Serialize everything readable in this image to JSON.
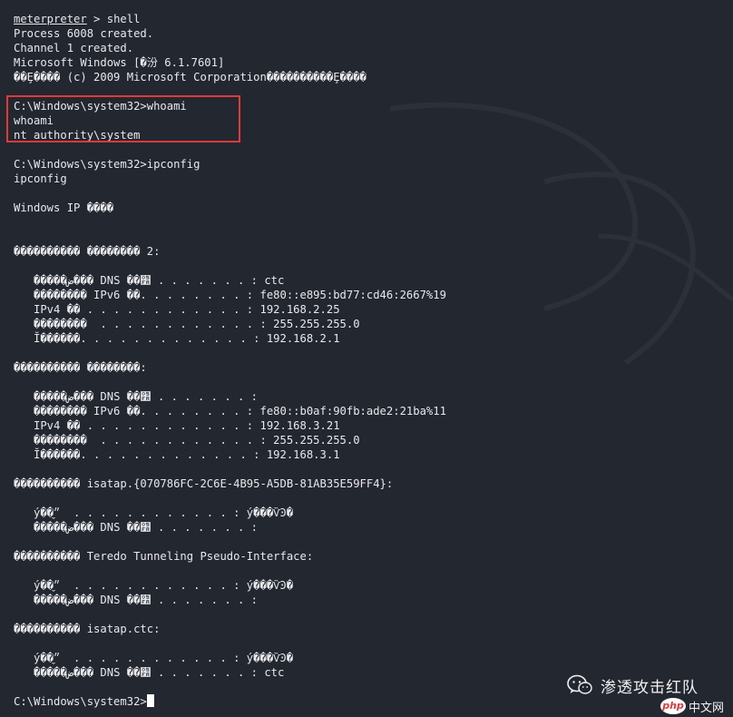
{
  "terminal": {
    "lines": [
      {
        "prompt": "meterpreter",
        "rest": " > shell"
      },
      {
        "text": "Process 6008 created."
      },
      {
        "text": "Channel 1 created."
      },
      {
        "text": "Microsoft Windows [�汾 6.1.7601]"
      },
      {
        "text": "��Ȩ���� (c) 2009 Microsoft Corporation����������Ȩ����"
      },
      {
        "text": ""
      },
      {
        "text": "C:\\Windows\\system32>whoami"
      },
      {
        "text": "whoami"
      },
      {
        "text": "nt authority\\system"
      },
      {
        "text": ""
      },
      {
        "text": "C:\\Windows\\system32>ipconfig"
      },
      {
        "text": "ipconfig"
      },
      {
        "text": ""
      },
      {
        "text": "Windows IP ����"
      },
      {
        "text": ""
      },
      {
        "text": ""
      },
      {
        "text": "���������� �������� 2:"
      },
      {
        "text": ""
      },
      {
        "text": "   �����ض��� DNS ��׺ . . . . . . . : ctc"
      },
      {
        "text": "   �������� IPv6 ��. . . . . . . . : fe80::e895:bd77:cd46:2667%19"
      },
      {
        "text": "   IPv4 �� . . . . . . . . . . . . : 192.168.2.25"
      },
      {
        "text": "   ��������  . . . . . . . . . . . . : 255.255.255.0"
      },
      {
        "text": "   Ĭ������. . . . . . . . . . . . . : 192.168.2.1"
      },
      {
        "text": ""
      },
      {
        "text": "���������� ��������:"
      },
      {
        "text": ""
      },
      {
        "text": "   �����ض��� DNS ��׺ . . . . . . . :"
      },
      {
        "text": "   �������� IPv6 ��. . . . . . . . : fe80::b0af:90fb:ade2:21ba%11"
      },
      {
        "text": "   IPv4 �� . . . . . . . . . . . . : 192.168.3.21"
      },
      {
        "text": "   ��������  . . . . . . . . . . . . : 255.255.255.0"
      },
      {
        "text": "   Ĭ������. . . . . . . . . . . . . : 192.168.3.1"
      },
      {
        "text": ""
      },
      {
        "text": "���������� isatap.{070786FC-2C6E-4B95-A5DB-81AB35E59FF4}:"
      },
      {
        "text": ""
      },
      {
        "text": "   ý��״̬  . . . . . . . . . . . . : ý���ѶϿ�"
      },
      {
        "text": "   �����ض��� DNS ��׺ . . . . . . . :"
      },
      {
        "text": ""
      },
      {
        "text": "���������� Teredo Tunneling Pseudo-Interface:"
      },
      {
        "text": ""
      },
      {
        "text": "   ý��״̬  . . . . . . . . . . . . : ý���ѶϿ�"
      },
      {
        "text": "   �����ض��� DNS ��׺ . . . . . . . :"
      },
      {
        "text": ""
      },
      {
        "text": "���������� isatap.ctc:"
      },
      {
        "text": ""
      },
      {
        "text": "   ý��״̬  . . . . . . . . . . . . : ý���ѶϿ�"
      },
      {
        "text": "   �����ض��� DNS ��׺ . . . . . . . : ctc"
      },
      {
        "text": ""
      },
      {
        "text": "C:\\Windows\\system32>",
        "cursor": true
      }
    ]
  },
  "watermark": {
    "icon": "wechat-icon",
    "text": "渗透攻击红队"
  },
  "php_badge": {
    "logo": "php",
    "site": "中文网"
  },
  "colors": {
    "background": "#232730",
    "text": "#e8e9ec",
    "highlight": "#e0393b"
  }
}
